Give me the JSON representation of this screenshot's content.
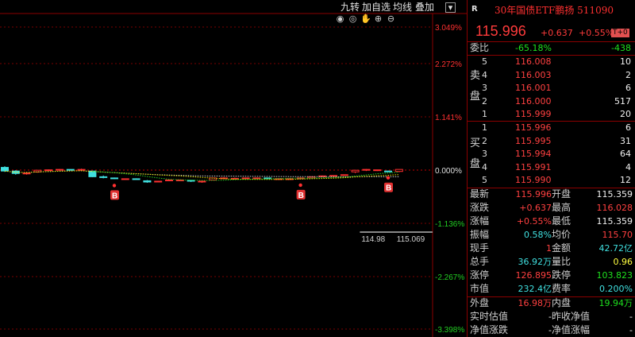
{
  "toolbar": {
    "buttons": [
      "九转",
      "加自选",
      "均线",
      "叠加"
    ],
    "icons": [
      "eye-open-icon",
      "eye-hide-icon",
      "hand-icon",
      "zoom-in-icon",
      "zoom-out-icon"
    ]
  },
  "chart_data": {
    "type": "candlestick",
    "y_axis_labels": [
      "3.049%",
      "2.272%",
      "1.141%",
      "0.000%",
      "-1.136%",
      "-2.267%",
      "-3.398%"
    ],
    "ylim_pct": [
      -3.398,
      3.049
    ],
    "reference_price": 115.359,
    "candles": [
      {
        "o": 115.42,
        "h": 115.45,
        "l": 115.31,
        "c": 115.33
      },
      {
        "o": 115.33,
        "h": 115.35,
        "l": 115.24,
        "c": 115.27
      },
      {
        "o": 115.28,
        "h": 115.31,
        "l": 115.24,
        "c": 115.28
      },
      {
        "o": 115.31,
        "h": 115.35,
        "l": 115.29,
        "c": 115.35
      },
      {
        "o": 115.36,
        "h": 115.37,
        "l": 115.34,
        "c": 115.36
      },
      {
        "o": 115.36,
        "h": 115.38,
        "l": 115.34,
        "c": 115.37
      },
      {
        "o": 115.37,
        "h": 115.37,
        "l": 115.35,
        "c": 115.36
      },
      {
        "o": 115.37,
        "h": 115.39,
        "l": 115.34,
        "c": 115.37
      },
      {
        "o": 115.33,
        "h": 115.33,
        "l": 115.18,
        "c": 115.19
      },
      {
        "o": 115.19,
        "h": 115.22,
        "l": 115.15,
        "c": 115.17
      },
      {
        "o": 115.16,
        "h": 115.17,
        "l": 115.13,
        "c": 115.14
      },
      {
        "o": 115.13,
        "h": 115.14,
        "l": 115.12,
        "c": 115.14
      },
      {
        "o": 115.14,
        "h": 115.15,
        "l": 115.12,
        "c": 115.13
      },
      {
        "o": 115.09,
        "h": 115.11,
        "l": 115.04,
        "c": 115.06
      },
      {
        "o": 115.07,
        "h": 115.09,
        "l": 115.06,
        "c": 115.08
      },
      {
        "o": 115.09,
        "h": 115.12,
        "l": 115.08,
        "c": 115.11
      },
      {
        "o": 115.1,
        "h": 115.12,
        "l": 115.09,
        "c": 115.11
      },
      {
        "o": 115.1,
        "h": 115.11,
        "l": 115.06,
        "c": 115.08
      },
      {
        "o": 115.07,
        "h": 115.09,
        "l": 115.04,
        "c": 115.08
      },
      {
        "o": 115.11,
        "h": 115.17,
        "l": 115.11,
        "c": 115.16
      },
      {
        "o": 115.15,
        "h": 115.18,
        "l": 115.14,
        "c": 115.16
      },
      {
        "o": 115.15,
        "h": 115.17,
        "l": 115.14,
        "c": 115.15
      },
      {
        "o": 115.16,
        "h": 115.17,
        "l": 115.15,
        "c": 115.16
      },
      {
        "o": 115.16,
        "h": 115.17,
        "l": 115.15,
        "c": 115.16
      },
      {
        "o": 115.16,
        "h": 115.16,
        "l": 115.13,
        "c": 115.15
      },
      {
        "o": 115.14,
        "h": 115.15,
        "l": 115.13,
        "c": 115.14
      },
      {
        "o": 115.14,
        "h": 115.15,
        "l": 115.13,
        "c": 115.14
      },
      {
        "o": 115.15,
        "h": 115.17,
        "l": 115.14,
        "c": 115.16
      },
      {
        "o": 115.16,
        "h": 115.19,
        "l": 115.15,
        "c": 115.19
      },
      {
        "o": 115.2,
        "h": 115.22,
        "l": 115.19,
        "c": 115.21
      },
      {
        "o": 115.22,
        "h": 115.22,
        "l": 115.21,
        "c": 115.22
      },
      {
        "o": 115.22,
        "h": 115.24,
        "l": 115.21,
        "c": 115.24
      },
      {
        "o": 115.31,
        "h": 115.36,
        "l": 115.28,
        "c": 115.35
      },
      {
        "o": 115.35,
        "h": 115.38,
        "l": 115.33,
        "c": 115.37
      },
      {
        "o": 115.34,
        "h": 115.36,
        "l": 115.33,
        "c": 115.36
      },
      {
        "o": 115.33,
        "h": 115.34,
        "l": 115.32,
        "c": 115.32
      },
      {
        "o": 115.32,
        "h": 115.37,
        "l": 115.3,
        "c": 115.37
      }
    ],
    "buy_markers": [
      {
        "index": 10,
        "label": "B"
      },
      {
        "index": 27,
        "label": "B"
      },
      {
        "index": 35,
        "label": "B"
      }
    ],
    "price_labels": [
      {
        "text": "114.98",
        "near_index": 33
      },
      {
        "text": "115.069",
        "near_index": 36
      }
    ],
    "ma_lines": [
      {
        "name": "MA-white",
        "color": "#d0d0d0",
        "style": "dotted"
      },
      {
        "name": "MA-yellow",
        "color": "#e6e600",
        "style": "dotted"
      },
      {
        "name": "MA-green",
        "color": "#22cc22",
        "style": "dotted"
      }
    ]
  },
  "panel": {
    "r_mark": "R",
    "title": "30年国债ETF鹏扬 511090",
    "price": "115.996",
    "change": "+0.637",
    "change_pct": "+0.55%",
    "t_badge": "T+0",
    "weibi": {
      "label": "委比",
      "pct": "-65.18%",
      "diff": "-438"
    },
    "sell_label": [
      "卖",
      "盘"
    ],
    "buy_label": [
      "买",
      "盘"
    ],
    "asks": [
      {
        "level": "5",
        "price": "116.008",
        "vol": "10"
      },
      {
        "level": "4",
        "price": "116.003",
        "vol": "2"
      },
      {
        "level": "3",
        "price": "116.001",
        "vol": "6"
      },
      {
        "level": "2",
        "price": "116.000",
        "vol": "517"
      },
      {
        "level": "1",
        "price": "115.999",
        "vol": "20"
      }
    ],
    "bids": [
      {
        "level": "1",
        "price": "115.996",
        "vol": "6"
      },
      {
        "level": "2",
        "price": "115.995",
        "vol": "31"
      },
      {
        "level": "3",
        "price": "115.994",
        "vol": "64"
      },
      {
        "level": "4",
        "price": "115.991",
        "vol": "4"
      },
      {
        "level": "5",
        "price": "115.990",
        "vol": "12"
      }
    ],
    "quotes": [
      {
        "k1": "最新",
        "v1": "115.996",
        "c1": "red",
        "k2": "开盘",
        "v2": "115.359",
        "c2": "white"
      },
      {
        "k1": "涨跌",
        "v1": "+0.637",
        "c1": "red",
        "k2": "最高",
        "v2": "116.028",
        "c2": "red"
      },
      {
        "k1": "涨幅",
        "v1": "+0.55%",
        "c1": "red",
        "k2": "最低",
        "v2": "115.359",
        "c2": "white"
      },
      {
        "k1": "振幅",
        "v1": "0.58%",
        "c1": "cyan",
        "k2": "均价",
        "v2": "115.70",
        "c2": "red"
      },
      {
        "k1": "现手",
        "v1": "1",
        "c1": "red",
        "k2": "金额",
        "v2": "42.72亿",
        "c2": "cyan"
      },
      {
        "k1": "总手",
        "v1": "36.92万",
        "c1": "cyan",
        "k2": "量比",
        "v2": "0.96",
        "c2": "yellow"
      },
      {
        "k1": "涨停",
        "v1": "126.895",
        "c1": "red",
        "k2": "跌停",
        "v2": "103.823",
        "c2": "green"
      },
      {
        "k1": "市值",
        "v1": "232.4亿",
        "c1": "cyan",
        "k2": "费率",
        "v2": "0.200%",
        "c2": "cyan"
      },
      {
        "k1": "外盘",
        "v1": "16.98万",
        "c1": "red",
        "k2": "内盘",
        "v2": "19.94万",
        "c2": "green"
      },
      {
        "k1": "实时估值",
        "v1": "-",
        "c1": "white",
        "k2": "昨收净值",
        "v2": "-",
        "c2": "white"
      },
      {
        "k1": "净值涨跌",
        "v1": "-",
        "c1": "white",
        "k2": "净值涨幅",
        "v2": "-",
        "c2": "white"
      }
    ]
  }
}
